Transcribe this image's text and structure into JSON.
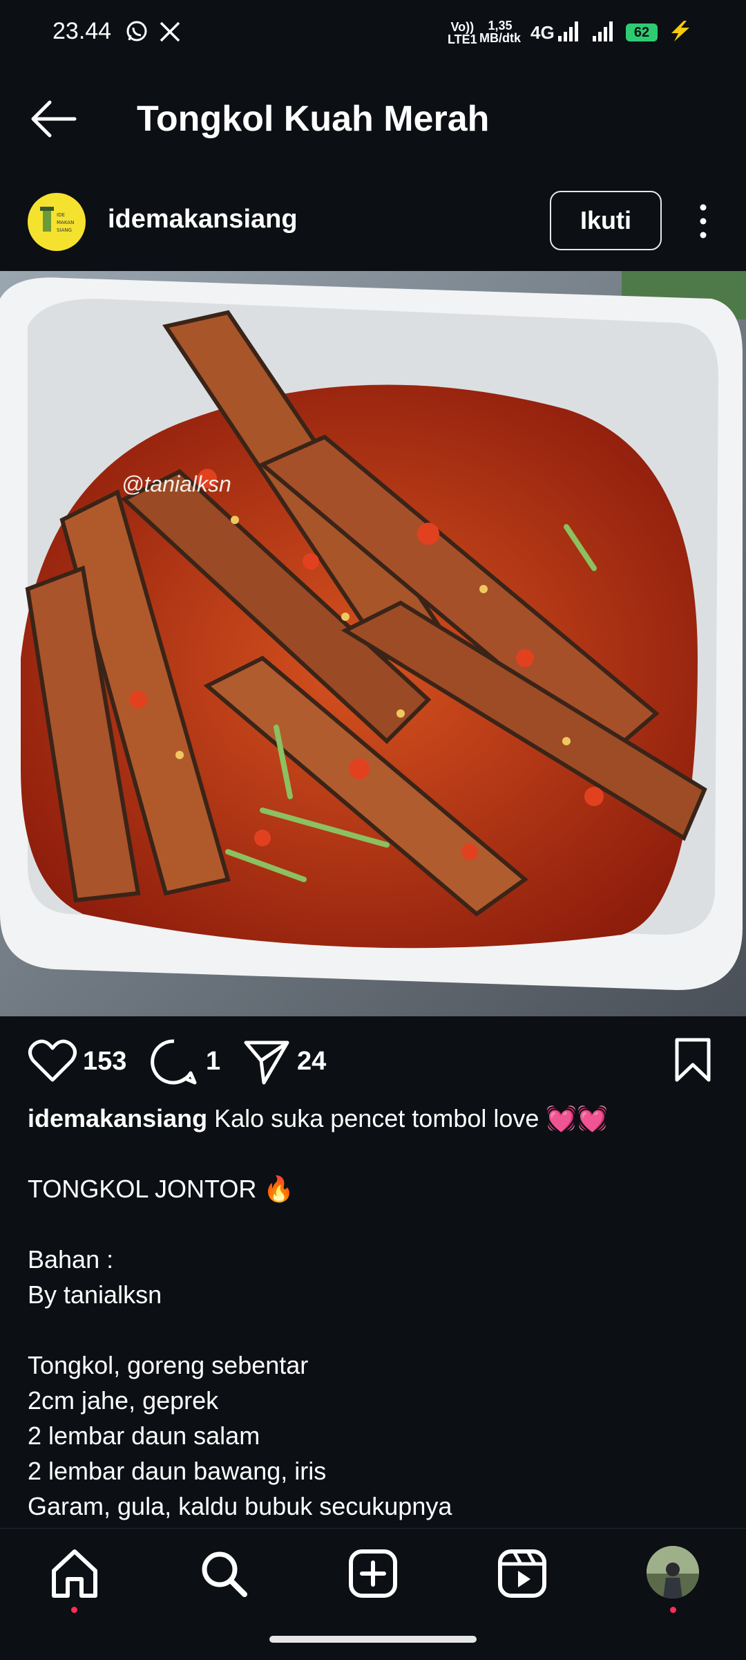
{
  "status_bar": {
    "time": "23.44",
    "volte_top": "Vo))",
    "volte_bottom": "LTE1",
    "speed_top": "1,35",
    "speed_bottom": "MB/dtk",
    "network": "4G",
    "battery": "62"
  },
  "header": {
    "title": "Tongkol Kuah Merah"
  },
  "post": {
    "username": "idemakansiang",
    "follow_label": "Ikuti",
    "avatar_text": [
      "IDE",
      "MAKAN",
      "SIANG"
    ],
    "image_watermark": "@tanialksn",
    "likes": "153",
    "comments": "1",
    "shares": "24"
  },
  "caption": {
    "username": "idemakansiang",
    "first_line": " Kalo suka pencet tombol love 💓💓",
    "lines": [
      "",
      "TONGKOL JONTOR 🔥",
      "",
      "Bahan :",
      "By tanialksn",
      "",
      "Tongkol, goreng sebentar",
      "2cm jahe, geprek",
      "2 lembar daun salam",
      "2 lembar daun bawang, iris",
      "Garam, gula, kaldu bubuk secukupnya"
    ]
  },
  "colors": {
    "background": "#0c0f14",
    "text": "#ffffff",
    "battery": "#2ecc71",
    "notification_dot": "#ff2d55",
    "avatar_bg": "#f5e22e"
  },
  "bottom_nav": [
    "home-icon",
    "search-icon",
    "create-icon",
    "reels-icon",
    "profile-avatar"
  ]
}
